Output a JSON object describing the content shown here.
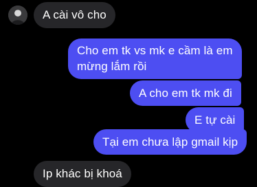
{
  "contact": {
    "avatar_icon": "profile-avatar-icon"
  },
  "messages": [
    {
      "sender": "other",
      "text": "A cài vô cho"
    },
    {
      "sender": "me",
      "text": "Cho em tk vs mk e cầm là em mừng lắm rồi"
    },
    {
      "sender": "me",
      "text": "A cho em tk mk đi"
    },
    {
      "sender": "me",
      "text": "E tự cài"
    },
    {
      "sender": "me",
      "text": "Tại em chưa lập gmail kịp"
    },
    {
      "sender": "other",
      "text": "Ip khác bị khoá"
    }
  ],
  "colors": {
    "background": "#000000",
    "incoming_bubble": "#262629",
    "outgoing_bubble": "#4d4ef2",
    "text": "#ffffff"
  }
}
